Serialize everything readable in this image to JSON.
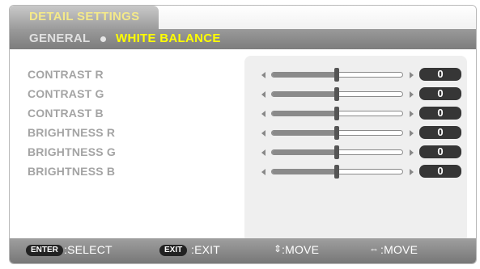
{
  "menu": {
    "title": "DETAIL SETTINGS"
  },
  "tabs": {
    "general": "GENERAL",
    "white_balance": "WHITE BALANCE",
    "active": "WHITE BALANCE"
  },
  "settings": [
    {
      "label": "CONTRAST R",
      "value": "0",
      "level": 0.5
    },
    {
      "label": "CONTRAST G",
      "value": "0",
      "level": 0.5
    },
    {
      "label": "CONTRAST B",
      "value": "0",
      "level": 0.5
    },
    {
      "label": "BRIGHTNESS R",
      "value": "0",
      "level": 0.5
    },
    {
      "label": "BRIGHTNESS G",
      "value": "0",
      "level": 0.5
    },
    {
      "label": "BRIGHTNESS B",
      "value": "0",
      "level": 0.5
    }
  ],
  "footer": {
    "enter_key": "ENTER",
    "enter_action": ":SELECT",
    "exit_key": "EXIT",
    "exit_action": ":EXIT",
    "updown_action": ":MOVE",
    "leftright_action": ":MOVE",
    "updown_icon": "up-down-arrows-icon",
    "leftright_icon": "left-right-arrows-icon"
  },
  "colors": {
    "active_tab_text": "#ffff00",
    "menu_title_text": "#f4e98a",
    "value_box": "#363636",
    "footer_background": "#8a8a8a"
  }
}
